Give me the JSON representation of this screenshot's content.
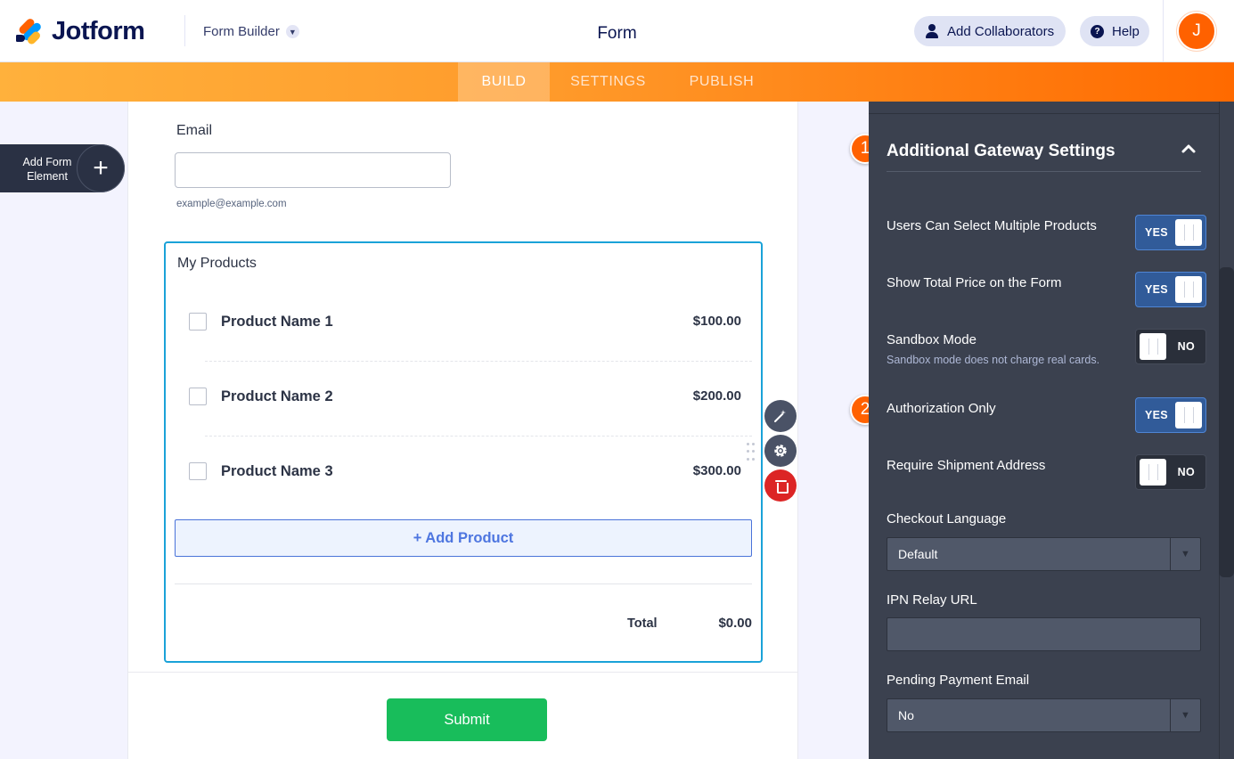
{
  "header": {
    "brand": "Jotform",
    "builder_label": "Form Builder",
    "form_title": "Form",
    "collaborators_label": "Add Collaborators",
    "help_label": "Help",
    "help_glyph": "?",
    "avatar_initial": "J"
  },
  "nav": {
    "tabs": [
      {
        "label": "BUILD",
        "active": true
      },
      {
        "label": "SETTINGS",
        "active": false
      },
      {
        "label": "PUBLISH",
        "active": false
      }
    ]
  },
  "sidebar": {
    "add_element_label": "Add Form Element",
    "add_element_glyph": "+"
  },
  "form": {
    "email": {
      "label": "Email",
      "value": "",
      "hint": "example@example.com"
    },
    "products": {
      "title": "My Products",
      "items": [
        {
          "name": "Product Name 1",
          "price": "$100.00",
          "checked": false
        },
        {
          "name": "Product Name 2",
          "price": "$200.00",
          "checked": false
        },
        {
          "name": "Product Name 3",
          "price": "$300.00",
          "checked": false
        }
      ],
      "add_product_label": "+ Add Product",
      "total_label": "Total",
      "total_value": "$0.00"
    },
    "submit_label": "Submit"
  },
  "tools": {
    "wand_icon": "magic-wand-icon",
    "settings_icon": "gear-icon",
    "delete_icon": "trash-icon"
  },
  "settings_panel": {
    "heading": "Additional Gateway Settings",
    "badges": [
      "1",
      "2"
    ],
    "toggles": [
      {
        "label": "Users Can Select Multiple Products",
        "value": "YES"
      },
      {
        "label": "Show Total Price on the Form",
        "value": "YES"
      },
      {
        "label": "Sandbox Mode",
        "sublabel": "Sandbox mode does not charge real cards.",
        "value": "NO"
      },
      {
        "label": "Authorization Only",
        "value": "YES"
      },
      {
        "label": "Require Shipment Address",
        "value": "NO"
      }
    ],
    "checkout_language": {
      "label": "Checkout Language",
      "value": "Default"
    },
    "ipn_relay_url": {
      "label": "IPN Relay URL",
      "value": ""
    },
    "pending_payment_email": {
      "label": "Pending Payment Email",
      "value": "No"
    }
  },
  "colors": {
    "accent_orange": "#ff6100",
    "nav_gradient_start": "#ffb13c",
    "nav_gradient_end": "#ff6a00",
    "panel_bg": "#3b414f",
    "toggle_yes_bg": "#315b99",
    "submit_green": "#18bd5b",
    "delete_red": "#dc2525",
    "product_border": "#1aa2d8"
  }
}
